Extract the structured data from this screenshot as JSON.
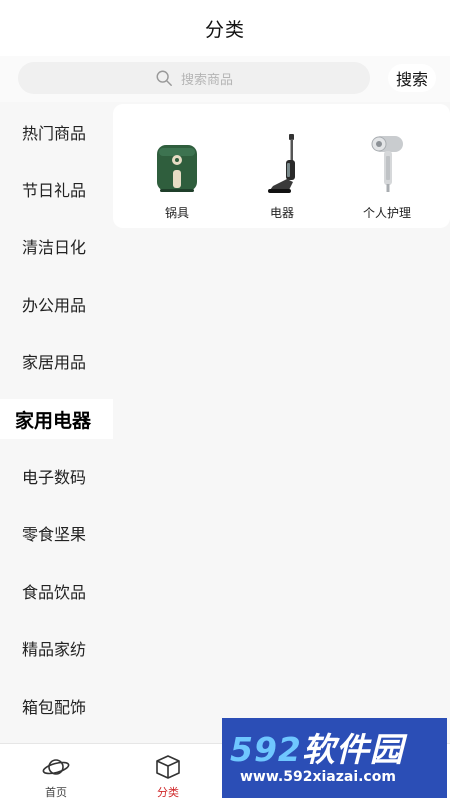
{
  "header": {
    "title": "分类"
  },
  "search": {
    "placeholder": "搜索商品",
    "button_label": "搜索"
  },
  "sidebar": {
    "items": [
      {
        "label": "热门商品",
        "active": false
      },
      {
        "label": "节日礼品",
        "active": false
      },
      {
        "label": "清洁日化",
        "active": false
      },
      {
        "label": "办公用品",
        "active": false
      },
      {
        "label": "家居用品",
        "active": false
      },
      {
        "label": "家用电器",
        "active": true
      },
      {
        "label": "电子数码",
        "active": false
      },
      {
        "label": "零食坚果",
        "active": false
      },
      {
        "label": "食品饮品",
        "active": false
      },
      {
        "label": "精品家纺",
        "active": false
      },
      {
        "label": "箱包配饰",
        "active": false
      }
    ]
  },
  "subcategories": [
    {
      "label": "锅具",
      "icon": "air-fryer-icon"
    },
    {
      "label": "电器",
      "icon": "floor-washer-icon"
    },
    {
      "label": "个人护理",
      "icon": "hair-dryer-icon"
    }
  ],
  "tabbar": {
    "tabs": [
      {
        "label": "首页",
        "icon": "planet-icon",
        "active": false
      },
      {
        "label": "分类",
        "icon": "cube-icon",
        "active": true
      },
      {
        "label": "",
        "icon": "cart-icon",
        "active": false
      },
      {
        "label": "",
        "icon": "user-icon",
        "active": false
      }
    ]
  },
  "watermark": {
    "brand_number": "592",
    "brand_text": "软件园",
    "url": "www.592xiazai.com"
  },
  "colors": {
    "accent": "#d0282a",
    "watermark_bg": "#2b4eb6"
  }
}
